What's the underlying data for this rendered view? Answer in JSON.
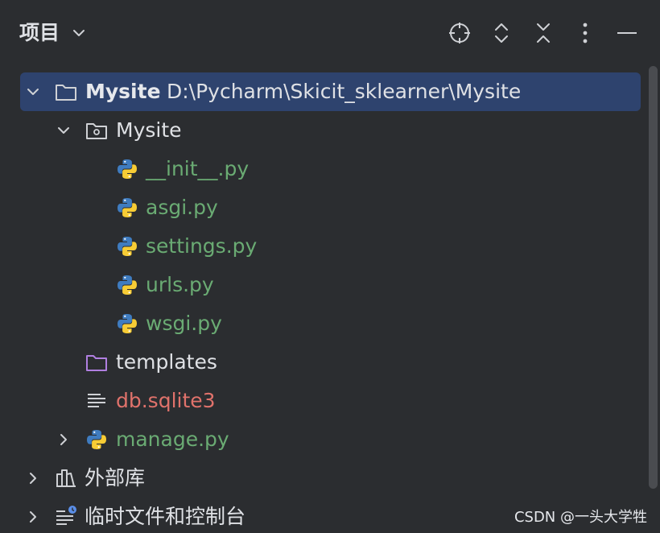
{
  "header": {
    "title": "项目",
    "icons": [
      "locate-icon",
      "expand-all-icon",
      "collapse-all-icon",
      "more-icon",
      "minimize-icon"
    ]
  },
  "tree": {
    "root": {
      "name": "Mysite",
      "path": "D:\\Pycharm\\Skicit_sklearner\\Mysite"
    },
    "package": {
      "name": "Mysite"
    },
    "files": [
      {
        "name": "__init__.py"
      },
      {
        "name": "asgi.py"
      },
      {
        "name": "settings.py"
      },
      {
        "name": "urls.py"
      },
      {
        "name": "wsgi.py"
      }
    ],
    "templates": {
      "name": "templates"
    },
    "db": {
      "name": "db.sqlite3"
    },
    "manage": {
      "name": "manage.py"
    },
    "external": {
      "name": "外部库"
    },
    "scratches": {
      "name": "临时文件和控制台"
    }
  },
  "colors": {
    "background": "#2b2d30",
    "selection": "#2e436e",
    "python_file": "#6aab73",
    "db_file": "#e0726b",
    "folder_purple": "#b07fe0"
  },
  "watermark": "CSDN @一头大学牲"
}
